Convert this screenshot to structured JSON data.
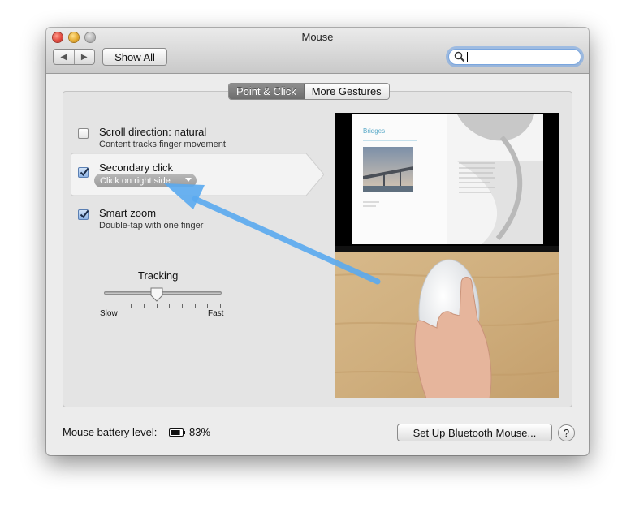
{
  "window": {
    "title": "Mouse"
  },
  "toolbar": {
    "back_icon": "back-arrow-icon",
    "forward_icon": "forward-arrow-icon",
    "show_all_label": "Show All",
    "search_value": ""
  },
  "tabs": [
    {
      "label": "Point & Click",
      "active": true
    },
    {
      "label": "More Gestures",
      "active": false
    }
  ],
  "options": [
    {
      "title": "Scroll direction: natural",
      "subtitle": "Content tracks finger movement",
      "checked": false
    },
    {
      "title": "Secondary click",
      "popup_value": "Click on right side",
      "checked": true
    },
    {
      "title": "Smart zoom",
      "subtitle": "Double-tap with one finger",
      "checked": true
    }
  ],
  "tracking": {
    "label": "Tracking",
    "min_label": "Slow",
    "max_label": "Fast",
    "level": 0.45,
    "ticks": 10
  },
  "preview": {
    "book_title": "Bridges",
    "book_subtitle": "A Celebration of World Marvel Structures"
  },
  "footer": {
    "battery_label": "Mouse battery level:",
    "battery_percent": "83%",
    "battery_level": 0.83,
    "setup_button_label": "Set Up Bluetooth Mouse...",
    "help_label": "?"
  },
  "colors": {
    "accent_blue": "#5aaaf0",
    "checkbox_blue": "#8fb4e5",
    "active_tab": "#7d7d7d"
  }
}
